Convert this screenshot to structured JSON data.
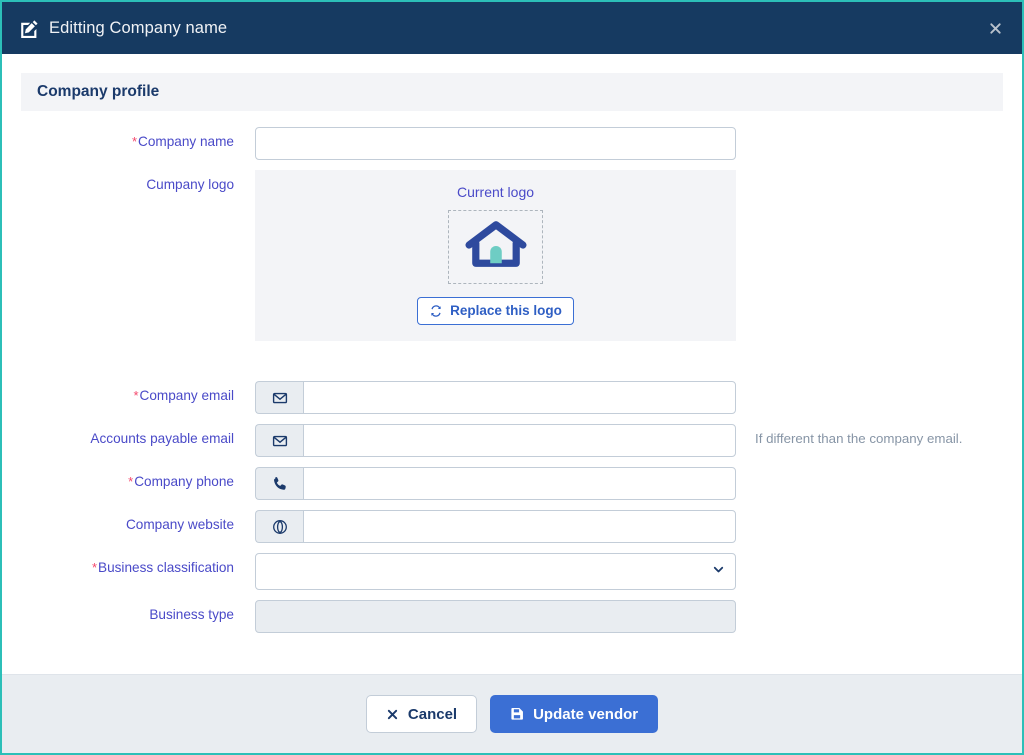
{
  "window": {
    "title": "Editting Company name",
    "title_icon": "edit-pencil-square-icon",
    "close_icon": "close-x-icon",
    "header_bg": "#163a61",
    "border_color": "#2cbfb8"
  },
  "section": {
    "title": "Company profile"
  },
  "form": {
    "company_name": {
      "label": "Company name",
      "required": true,
      "value": "",
      "placeholder": ""
    },
    "company_logo": {
      "label": "Cumpany logo",
      "required": false,
      "caption": "Current logo",
      "logo_icon": "house-home-icon",
      "logo_outline_color": "#2e4a9e",
      "logo_door_color": "#6ecdc4",
      "replace_button": {
        "label": "Replace this logo",
        "icon": "refresh-sync-icon"
      }
    },
    "company_email": {
      "label": "Company email",
      "required": true,
      "icon": "envelope-icon",
      "value": "",
      "placeholder": ""
    },
    "accounts_payable_email": {
      "label": "Accounts payable email",
      "required": false,
      "icon": "envelope-icon",
      "value": "",
      "placeholder": "",
      "help": "If different than the company email."
    },
    "company_phone": {
      "label": "Company phone",
      "required": true,
      "icon": "phone-icon",
      "value": "",
      "placeholder": ""
    },
    "company_website": {
      "label": "Company website",
      "required": false,
      "icon": "compass-globe-icon",
      "value": "",
      "placeholder": ""
    },
    "business_classification": {
      "label": "Business classification",
      "required": true,
      "selected": "",
      "options": [
        ""
      ],
      "caret_icon": "chevron-down-icon"
    },
    "business_type": {
      "label": "Business type",
      "required": false,
      "value": "",
      "placeholder": "",
      "disabled": true
    }
  },
  "footer": {
    "cancel": {
      "label": "Cancel",
      "icon": "x-icon"
    },
    "submit": {
      "label": "Update vendor",
      "icon": "save-floppy-icon",
      "color": "#3b6fd4"
    }
  },
  "required_marker": "*"
}
